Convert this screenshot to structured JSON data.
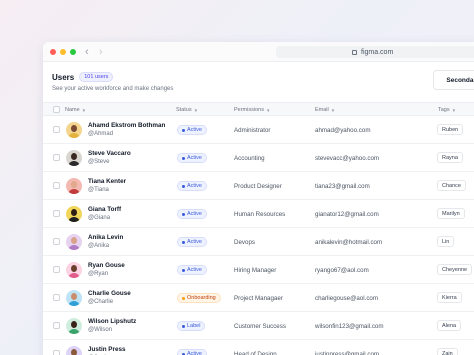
{
  "browser": {
    "url": "figma.com",
    "back": "‹",
    "forward": "›"
  },
  "header": {
    "title": "Users",
    "count_badge": "101 users",
    "subtitle": "See your active workforce and make changes",
    "secondary_button": "Secondary"
  },
  "table": {
    "columns": {
      "name": "Name",
      "status": "Status",
      "permissions": "Permissions",
      "email": "Email",
      "tags": "Tags"
    },
    "rows": [
      {
        "name": "Ahamd Ekstrom Bothman",
        "handle": "@Ahmad",
        "status": "Active",
        "status_tone": "blue",
        "permission": "Administrator",
        "email": "ahmad@yahoo.com",
        "tag": "Ruben",
        "skin": "#7a4a34",
        "shirt": "#e3b23c",
        "bg": "#f4d58d"
      },
      {
        "name": "Steve Vaccaro",
        "handle": "@Steve",
        "status": "Active",
        "status_tone": "blue",
        "permission": "Accounting",
        "email": "stevevacc@yahoo.com",
        "tag": "Rayna",
        "skin": "#3b2a22",
        "shirt": "#2b2b2b",
        "bg": "#d9d6d0"
      },
      {
        "name": "Tiana Kenter",
        "handle": "@Tiana",
        "status": "Active",
        "status_tone": "blue",
        "permission": "Product Designer",
        "email": "tiana23@gmail.com",
        "tag": "Chance",
        "skin": "#e0a88c",
        "shirt": "#c23b3b",
        "bg": "#f3b8b0"
      },
      {
        "name": "Giana Torff",
        "handle": "@Giana",
        "status": "Active",
        "status_tone": "blue",
        "permission": "Human Resources",
        "email": "gianator12@gmail.com",
        "tag": "Marilyn",
        "skin": "#2e1e16",
        "shirt": "#1f1f1f",
        "bg": "#f1d65a"
      },
      {
        "name": "Anika Levin",
        "handle": "@Anika",
        "status": "Active",
        "status_tone": "blue",
        "permission": "Devops",
        "email": "anikalevin@hotmail.com",
        "tag": "Lin",
        "skin": "#d9a38a",
        "shirt": "#b07cc6",
        "bg": "#e7d3f0"
      },
      {
        "name": "Ryan Gouse",
        "handle": "@Ryan",
        "status": "Active",
        "status_tone": "blue",
        "permission": "Hiring Manager",
        "email": "ryango67@aol.com",
        "tag": "Cheyenne",
        "skin": "#6b3f2c",
        "shirt": "#e15b8c",
        "bg": "#fbd3e2"
      },
      {
        "name": "Charlie Gouse",
        "handle": "@Charlie",
        "status": "Onboarding",
        "status_tone": "orange",
        "permission": "Project Managaer",
        "email": "charliegouse@aol.com",
        "tag": "Kierra",
        "skin": "#c98d6e",
        "shirt": "#2f9fd6",
        "bg": "#bde3f5"
      },
      {
        "name": "Wilson Lipshutz",
        "handle": "@Wilson",
        "status": "Label",
        "status_tone": "blue",
        "permission": "Customer Success",
        "email": "wilsonfin123@gmail.com",
        "tag": "Alena",
        "skin": "#3a2418",
        "shirt": "#3aa36b",
        "bg": "#cfeedd"
      },
      {
        "name": "Justin Press",
        "handle": "@Justin",
        "status": "Active",
        "status_tone": "blue",
        "permission": "Head of Design",
        "email": "justinpress@gmail.com",
        "tag": "Zain",
        "skin": "#8b5a3c",
        "shirt": "#7d5bd0",
        "bg": "#ddd3f7"
      }
    ]
  }
}
